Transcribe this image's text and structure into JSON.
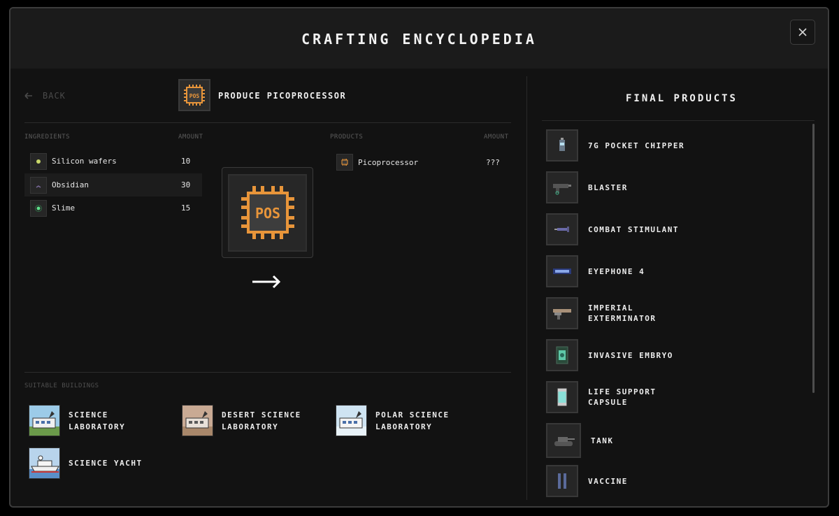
{
  "title": "CRAFTING ENCYCLOPEDIA",
  "close_label": "×",
  "back_label": "BACK",
  "recipe_title": "PRODUCE PICOPROCESSOR",
  "recipe_icon_text": "POS",
  "ingredients_header": "INGREDIENTS",
  "amount_header": "AMOUNT",
  "products_header": "PRODUCTS",
  "ingredients": [
    {
      "name": "Silicon wafers",
      "amount": "10",
      "icon": "silicon-wafer-icon"
    },
    {
      "name": "Obsidian",
      "amount": "30",
      "icon": "obsidian-icon"
    },
    {
      "name": "Slime",
      "amount": "15",
      "icon": "slime-icon"
    }
  ],
  "products": [
    {
      "name": "Picoprocessor",
      "amount": "???",
      "icon": "picoprocessor-icon"
    }
  ],
  "buildings_header": "SUITABLE BUILDINGS",
  "buildings": [
    {
      "line1": "SCIENCE",
      "line2": "LABORATORY",
      "icon": "science-lab-icon"
    },
    {
      "line1": "DESERT SCIENCE",
      "line2": "LABORATORY",
      "icon": "desert-lab-icon"
    },
    {
      "line1": "POLAR SCIENCE",
      "line2": "LABORATORY",
      "icon": "polar-lab-icon"
    },
    {
      "line1": "SCIENCE YACHT",
      "line2": "",
      "icon": "science-yacht-icon"
    }
  ],
  "final_products_title": "FINAL PRODUCTS",
  "final_products": [
    {
      "line1": "7G POCKET CHIPPER",
      "line2": ""
    },
    {
      "line1": "BLASTER",
      "line2": ""
    },
    {
      "line1": "COMBAT STIMULANT",
      "line2": ""
    },
    {
      "line1": "EYEPHONE 4",
      "line2": ""
    },
    {
      "line1": "IMPERIAL",
      "line2": "EXTERMINATOR"
    },
    {
      "line1": "INVASIVE EMBRYO",
      "line2": ""
    },
    {
      "line1": "LIFE SUPPORT",
      "line2": "CAPSULE"
    },
    {
      "line1": "TANK",
      "line2": ""
    },
    {
      "line1": "VACCINE",
      "line2": ""
    }
  ],
  "colors": {
    "accent_orange": "#e8953a",
    "background": "#121212",
    "header": "#1b1b1b"
  }
}
